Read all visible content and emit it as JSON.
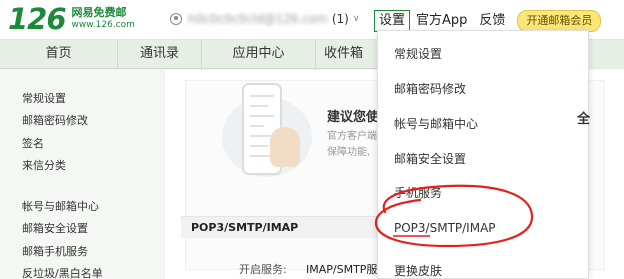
{
  "header": {
    "logo_num": "126",
    "logo_name": "网易免费邮",
    "logo_url": "www.126.com",
    "account_email": "h0c0c0c0cld@126.com",
    "account_count": "(1)",
    "account_caret": "∨",
    "links": [
      "设置",
      "官方App",
      "反馈"
    ],
    "vip_label": "开通邮箱会员"
  },
  "nav": {
    "tabs": [
      "首页",
      "通讯录",
      "应用中心",
      "收件箱"
    ]
  },
  "sidebar": {
    "items": [
      "常规设置",
      "邮箱密码修改",
      "签名",
      "来信分类",
      "帐号与邮箱中心",
      "邮箱安全设置",
      "邮箱手机服务",
      "反垃圾/黑白名单"
    ]
  },
  "main": {
    "tip_title": "建议您使",
    "tip_body": "官方客户端 保障功能,",
    "tip_suffix": "全",
    "pop_bar": "POP3/SMTP/IMAP",
    "service_label": "开启服务:",
    "service_value": "IMAP/SMTP服务"
  },
  "dropdown": {
    "items": [
      "常规设置",
      "邮箱密码修改",
      "帐号与邮箱中心",
      "邮箱安全设置",
      "手机服务",
      "POP3/SMTP/IMAP",
      "更换皮肤"
    ]
  },
  "colors": {
    "brand_green": "#1d8a3a",
    "annotation_red": "#e3211c"
  }
}
